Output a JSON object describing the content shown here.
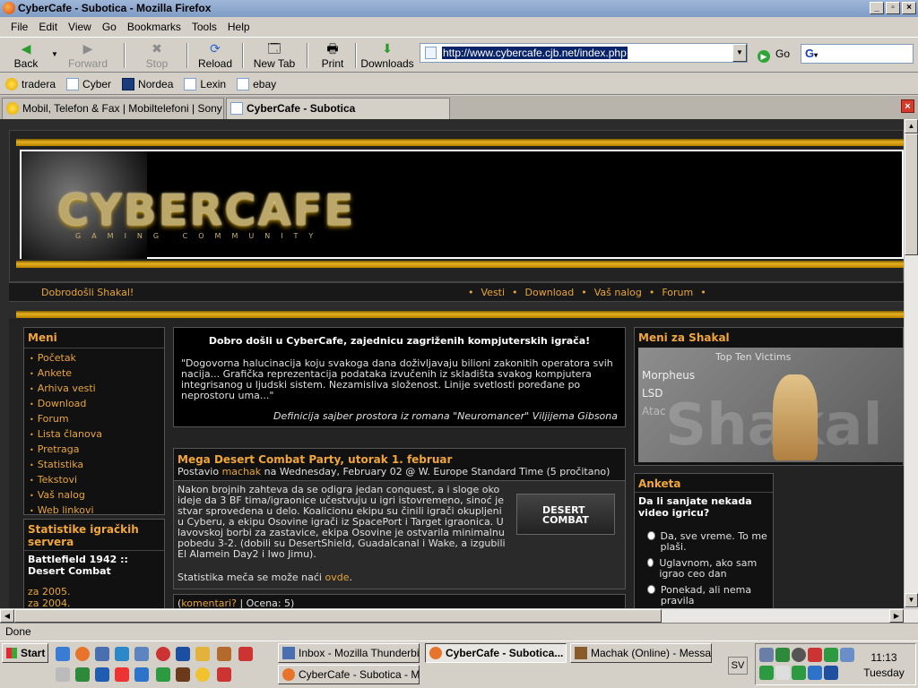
{
  "window": {
    "title": "CyberCafe - Subotica - Mozilla Firefox"
  },
  "menubar": [
    "File",
    "Edit",
    "View",
    "Go",
    "Bookmarks",
    "Tools",
    "Help"
  ],
  "toolbar": {
    "back": "Back",
    "forward": "Forward",
    "stop": "Stop",
    "reload": "Reload",
    "new_tab": "New Tab",
    "print": "Print",
    "downloads": "Downloads",
    "url": "http://www.cybercafe.cjb.net/index.php",
    "go": "Go",
    "search_glyph": "G"
  },
  "bookmarks": [
    "tradera",
    "Cyber",
    "Nordea",
    "Lexin",
    "ebay"
  ],
  "tabs": [
    {
      "label": "Mobil, Telefon & Fax | Mobiltelefoni | Sony Eri..."
    },
    {
      "label": "CyberCafe - Subotica"
    }
  ],
  "page": {
    "banner_title": "CYBERCAFE",
    "banner_sub": "GAMING COMMUNITY",
    "welcome": "Dobrodošli Shakal!",
    "topnav": [
      "Vesti",
      "Download",
      "Vaš nalog",
      "Forum"
    ],
    "menu": {
      "title": "Meni",
      "items": [
        "Početak",
        "Ankete",
        "Arhiva vesti",
        "Download",
        "Forum",
        "Lista članova",
        "Pretraga",
        "Statistika",
        "Tekstovi",
        "Vaš nalog",
        "Web linkovi"
      ]
    },
    "stats": {
      "title": "Statistike igračkih servera",
      "game": "Battlefield 1942 :: Desert Combat",
      "links": [
        "za 2005.",
        "za 2004."
      ]
    },
    "intro": {
      "heading": "Dobro došli u CyberCafe, zajednicu zagriženih kompjuterskih igrača!",
      "quote": "\"Dogovorna halucinacija koju svakoga dana doživljavaju bilioni zakonitih operatora svih nacija... Grafička reprezentacija podataka izvučenih iz skladišta svakog kompjutera integrisanog u ljudski sistem. Nezamisliva složenost. Linije svetlosti poređane po neprostoru uma...\"",
      "source": "Definicija sajber prostora iz romana \"Neuromancer\" Viljijema Gibsona"
    },
    "news": {
      "title": "Mega Desert Combat Party, utorak 1. februar",
      "byline_prefix": "Postavio",
      "author": "machak",
      "byline_suffix": "na Wednesday, February 02 @ W. Europe Standard Time (5 pročitano)",
      "body": "Nakon brojnih zahteva da se odigra jedan conquest, a i sloge oko ideje da 3 BF tima/igraonice učestvuju u igri istovremeno, sinoć je stvar sprovedena u delo. Koalicionu ekipu su činili igrači okupljeni u Cyberu, a ekipu Osovine igrači iz SpacePort i Target igraonica. U lavovskoj borbi za zastavice, ekipa Osovine je ostvarila minimalnu pobedu 3-2. (dobili su DesertShield, Guadalcanal i Wake, a izgubili El Alamein Day2 i Iwo Jimu).",
      "stats_prefix": "Statistika meča se može naći",
      "stats_link": "ovde",
      "stats_suffix": ".",
      "img_label": "DESERT COMBAT",
      "comments": "komentari?",
      "rating": "| Ocena: 5)"
    },
    "user_menu": {
      "title": "Meni za Shakal",
      "img_caption": "Top Ten Victims",
      "img_names": [
        "Morpheus",
        "LSD",
        "Atac"
      ],
      "img_word": "Shakal"
    },
    "poll": {
      "title": "Anketa",
      "question": "Da li sanjate nekada video igricu?",
      "options": [
        "Da, sve vreme. To me plaši.",
        "Uglavnom, ako sam igrao ceo dan",
        "Ponekad, ali nema pravila"
      ]
    }
  },
  "statusbar": {
    "text": "Done"
  },
  "taskbar": {
    "start": "Start",
    "tasks": [
      {
        "label": "Inbox - Mozilla Thunderbird"
      },
      {
        "label": "CyberCafe - Subotica..."
      },
      {
        "label": "Machak (Online) - Messa..."
      },
      {
        "label": "CyberCafe - Subotica - Mi..."
      }
    ],
    "lang": "SV",
    "time": "11:13",
    "day": "Tuesday"
  },
  "colors": {
    "accent": "#e8a53a",
    "page_bg": "#2c2c2c",
    "title_bg": "#8ea9d2",
    "gold": "#e6b020"
  }
}
